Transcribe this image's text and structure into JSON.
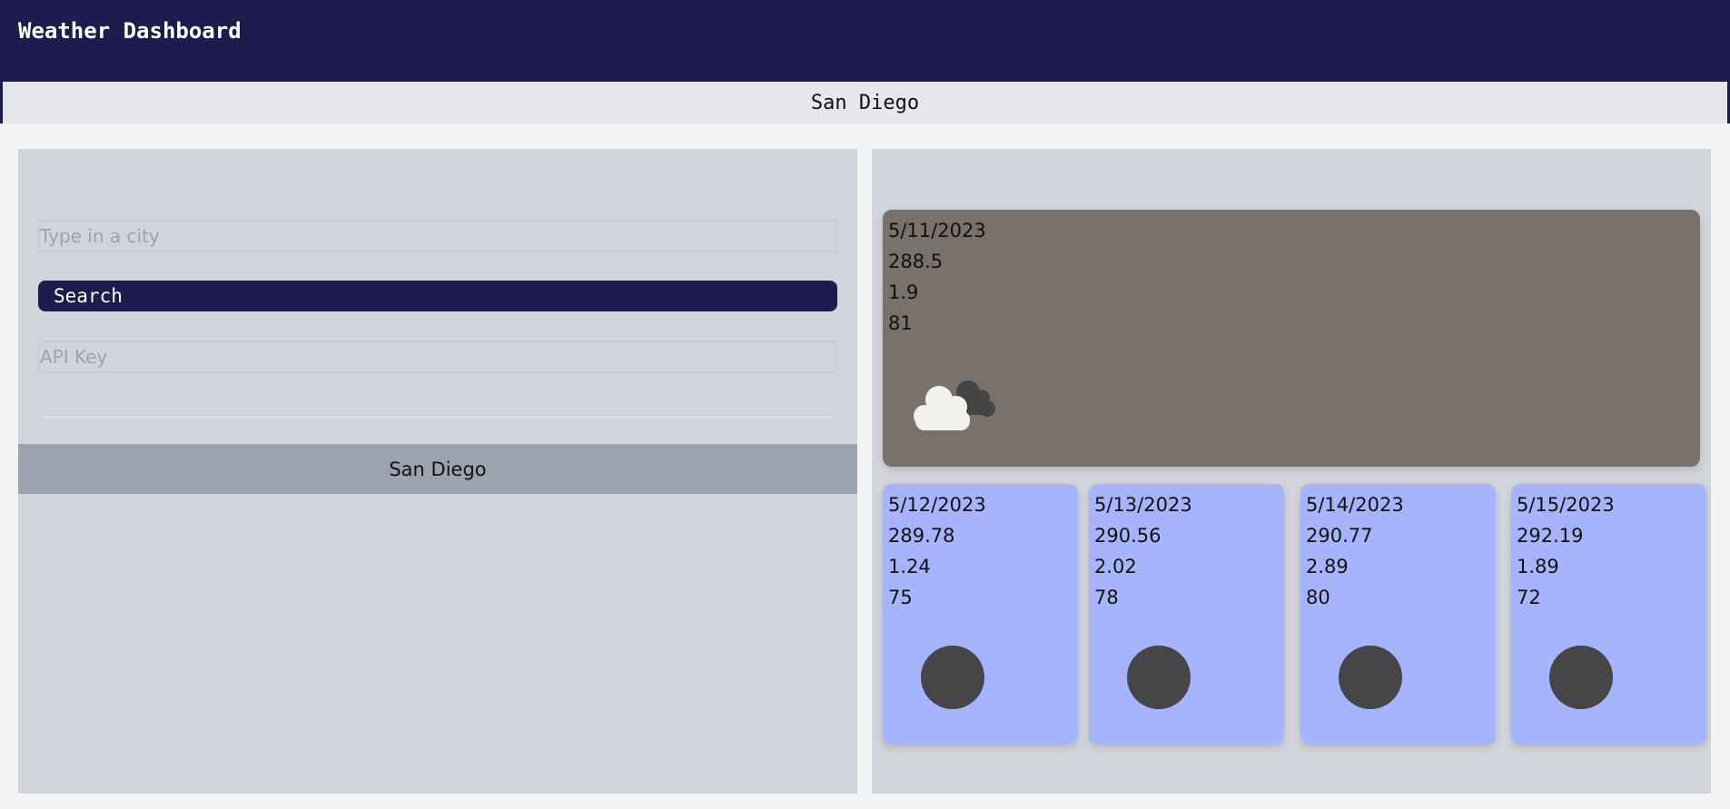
{
  "header": {
    "title": "Weather Dashboard"
  },
  "selected_city": "San Diego",
  "search": {
    "city_placeholder": "Type in a city",
    "button_label": "Search",
    "api_key_placeholder": "API Key"
  },
  "history": [
    {
      "label": "San Diego"
    }
  ],
  "today": {
    "date": "5/11/2023",
    "temp": "288.5",
    "wind": "1.9",
    "humidity": "81",
    "icon": "cloud-icon"
  },
  "forecast": [
    {
      "date": "5/12/2023",
      "temp": "289.78",
      "wind": "1.24",
      "humidity": "75",
      "icon": "dark-circle-icon"
    },
    {
      "date": "5/13/2023",
      "temp": "290.56",
      "wind": "2.02",
      "humidity": "78",
      "icon": "dark-circle-icon"
    },
    {
      "date": "5/14/2023",
      "temp": "290.77",
      "wind": "2.89",
      "humidity": "80",
      "icon": "dark-circle-icon"
    },
    {
      "date": "5/15/2023",
      "temp": "292.19",
      "wind": "1.89",
      "humidity": "72",
      "icon": "dark-circle-icon"
    }
  ],
  "colors": {
    "header_bg": "#1e1b4e",
    "panel_bg": "#d1d5db",
    "today_card_bg": "#78716c",
    "forecast_card_bg": "#a5b4fc",
    "history_item_bg": "#9ca3af"
  }
}
